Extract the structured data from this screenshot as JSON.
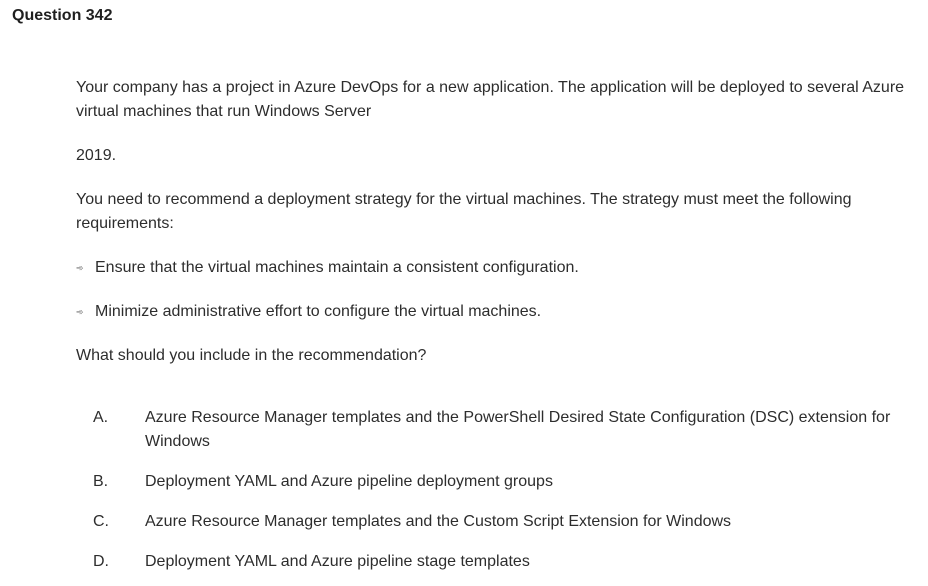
{
  "question": {
    "title": "Question 342",
    "intro": "Your company has a project in Azure DevOps for a new application. The application will be deployed to several Azure virtual machines that run Windows Server",
    "year": "2019.",
    "need": "You need to recommend a deployment strategy for the virtual machines. The strategy must meet the following requirements:",
    "requirements": [
      {
        "icon": "arrow-bullet-icon",
        "glyph": "➾",
        "text": "Ensure that the virtual machines maintain a consistent configuration."
      },
      {
        "icon": "arrow-bullet-icon",
        "glyph": "➾",
        "text": "Minimize administrative effort to configure the virtual machines."
      }
    ],
    "ask": "What should you include in the recommendation?",
    "options": [
      {
        "letter": "A.",
        "text": "Azure Resource Manager templates and the PowerShell Desired State Configuration (DSC) extension for Windows"
      },
      {
        "letter": "B.",
        "text": "Deployment YAML and Azure pipeline deployment groups"
      },
      {
        "letter": "C.",
        "text": "Azure Resource Manager templates and the Custom Script Extension for Windows"
      },
      {
        "letter": "D.",
        "text": "Deployment YAML and Azure pipeline stage templates"
      }
    ]
  }
}
